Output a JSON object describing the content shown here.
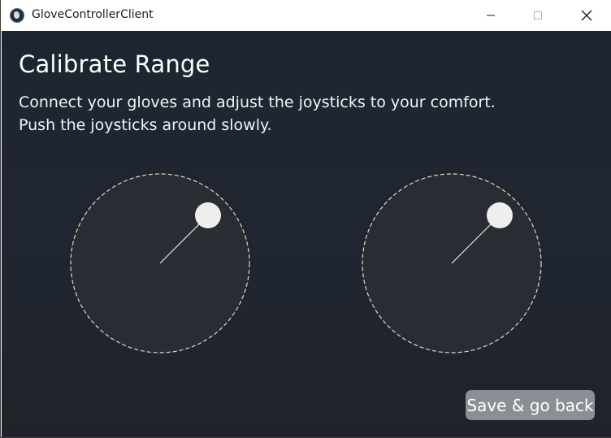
{
  "window": {
    "title": "GloveControllerClient",
    "icon": "app-icon",
    "controls": [
      "minimize-icon",
      "maximize-icon",
      "close-icon"
    ]
  },
  "main": {
    "heading": "Calibrate Range",
    "instructions": [
      "Connect your gloves and adjust the joysticks to your comfort.",
      "Push the joysticks around slowly."
    ],
    "save_label": "Save & go back"
  },
  "colors": {
    "background_top": "#1d2530",
    "background_bottom": "#1f2329",
    "pad_fill": "#2a2c33",
    "pad_ring": "#22242a",
    "thumb": "#eeeeee",
    "button_bg": "#8a8f95"
  }
}
